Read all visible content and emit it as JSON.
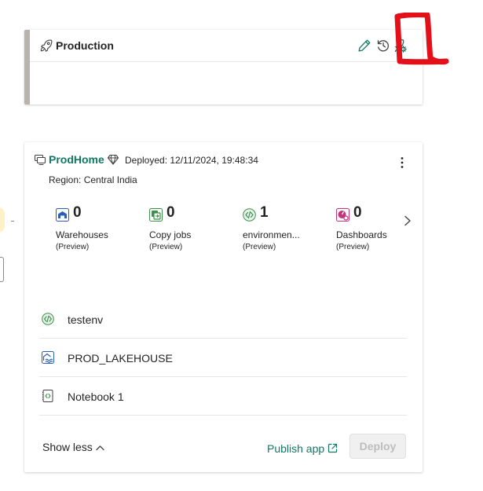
{
  "stage": {
    "title": "Production",
    "icons": [
      "rocket-icon",
      "edit-icon",
      "history-icon",
      "stage-settings-icon"
    ]
  },
  "workspace": {
    "name": "ProdHome",
    "deployed": "Deployed: 12/11/2024, 19:48:34",
    "region": "Region: Central India",
    "stats": [
      {
        "count": "0",
        "label": "Warehouses",
        "sub": "(Preview)",
        "icon": "warehouse-icon"
      },
      {
        "count": "0",
        "label": "Copy jobs",
        "sub": "(Preview)",
        "icon": "copy-job-icon"
      },
      {
        "count": "1",
        "label": "environmen...",
        "sub": "(Preview)",
        "icon": "environment-icon"
      },
      {
        "count": "0",
        "label": "Dashboards",
        "sub": "(Preview)",
        "icon": "dashboard-icon"
      }
    ],
    "items": [
      {
        "name": "testenv",
        "icon": "environment-icon"
      },
      {
        "name": "PROD_LAKEHOUSE",
        "icon": "lakehouse-icon"
      },
      {
        "name": "Notebook 1",
        "icon": "notebook-icon"
      }
    ],
    "show_less": "Show less",
    "publish_app": "Publish app",
    "deploy": "Deploy"
  },
  "colors": {
    "brand": "#117865",
    "annotation": "#e3101a"
  }
}
